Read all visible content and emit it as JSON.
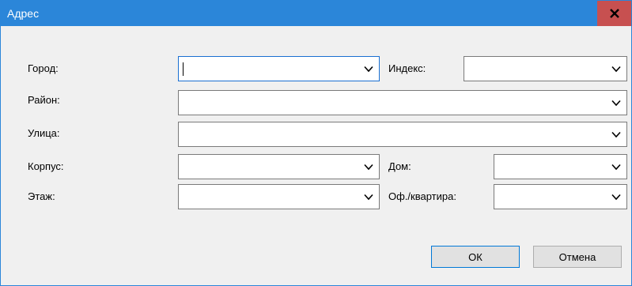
{
  "window": {
    "title": "Адрес",
    "close_icon": "close-icon",
    "colors": {
      "titlebar": "#2b86d9",
      "close_hover": "#c75050",
      "client": "#f0f0f0"
    }
  },
  "form": {
    "city": {
      "label": "Город:",
      "value": ""
    },
    "index": {
      "label": "Индекс:",
      "value": ""
    },
    "district": {
      "label": "Район:",
      "value": ""
    },
    "street": {
      "label": "Улица:",
      "value": ""
    },
    "building": {
      "label": "Корпус:",
      "value": ""
    },
    "house": {
      "label": "Дом:",
      "value": ""
    },
    "floor": {
      "label": "Этаж:",
      "value": ""
    },
    "apartment": {
      "label": "Оф./квартира:",
      "value": ""
    }
  },
  "buttons": {
    "ok": "ОК",
    "cancel": "Отмена"
  },
  "icons": {
    "dropdown": "chevron-down-icon"
  }
}
